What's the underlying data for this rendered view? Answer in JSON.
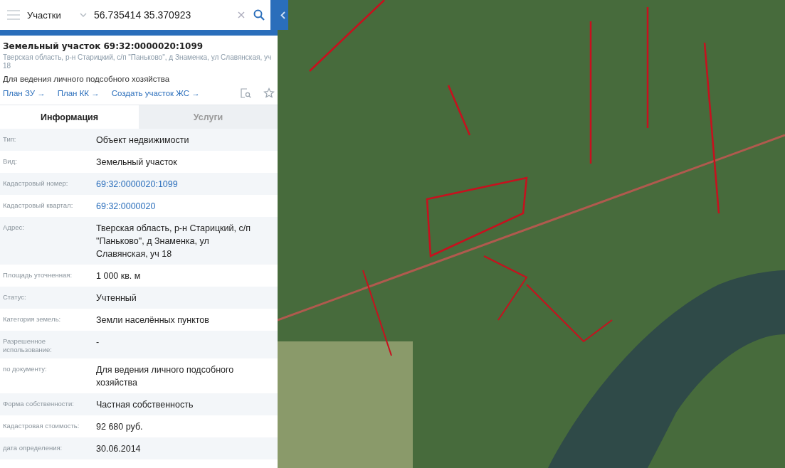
{
  "search": {
    "layer": "Участки",
    "value": "56.735414 35.370923"
  },
  "parcel": {
    "title": "Земельный участок 69:32:0000020:1099",
    "address": "Тверская область, р-н Старицкий, с/п \"Паньково\", д Знаменка, ул Славянская, уч 18",
    "purpose": "Для ведения личного подсобного хозяйства",
    "links": [
      "План ЗУ →",
      "План КК →",
      "Создать участок ЖС →"
    ]
  },
  "tabs": [
    {
      "label": "Информация",
      "selected": true
    },
    {
      "label": "Услуги",
      "selected": false
    }
  ],
  "info_rows": [
    {
      "label": "Тип:",
      "value": "Объект недвижимости",
      "kind": "text"
    },
    {
      "label": "Вид:",
      "value": "Земельный участок",
      "kind": "text"
    },
    {
      "label": "Кадастровый номер:",
      "value": "69:32:0000020:1099",
      "kind": "link"
    },
    {
      "label": "Кадастровый квартал:",
      "value": "69:32:0000020",
      "kind": "link"
    },
    {
      "label": "Адрес:",
      "value": "Тверская область, р-н Старицкий, с/п \"Паньково\", д Знаменка, ул Славянская, уч 18",
      "kind": "text"
    },
    {
      "label": "Площадь уточненная:",
      "value": "1 000 кв. м",
      "kind": "text"
    },
    {
      "label": "Статус:",
      "value": "Учтенный",
      "kind": "text"
    },
    {
      "label": "Категория земель:",
      "value": "Земли населённых пунктов",
      "kind": "text"
    },
    {
      "label": "Разрешенное использование:",
      "value": "-",
      "kind": "text"
    },
    {
      "label": "по документу:",
      "value": "Для ведения личного подсобного хозяйства",
      "kind": "text"
    },
    {
      "label": "Форма собственности:",
      "value": "Частная собственность",
      "kind": "text"
    },
    {
      "label": "Кадастровая стоимость:",
      "value": "92 680 руб.",
      "kind": "text"
    },
    {
      "label": "дата определения:",
      "value": "30.06.2014",
      "kind": "text"
    }
  ]
}
